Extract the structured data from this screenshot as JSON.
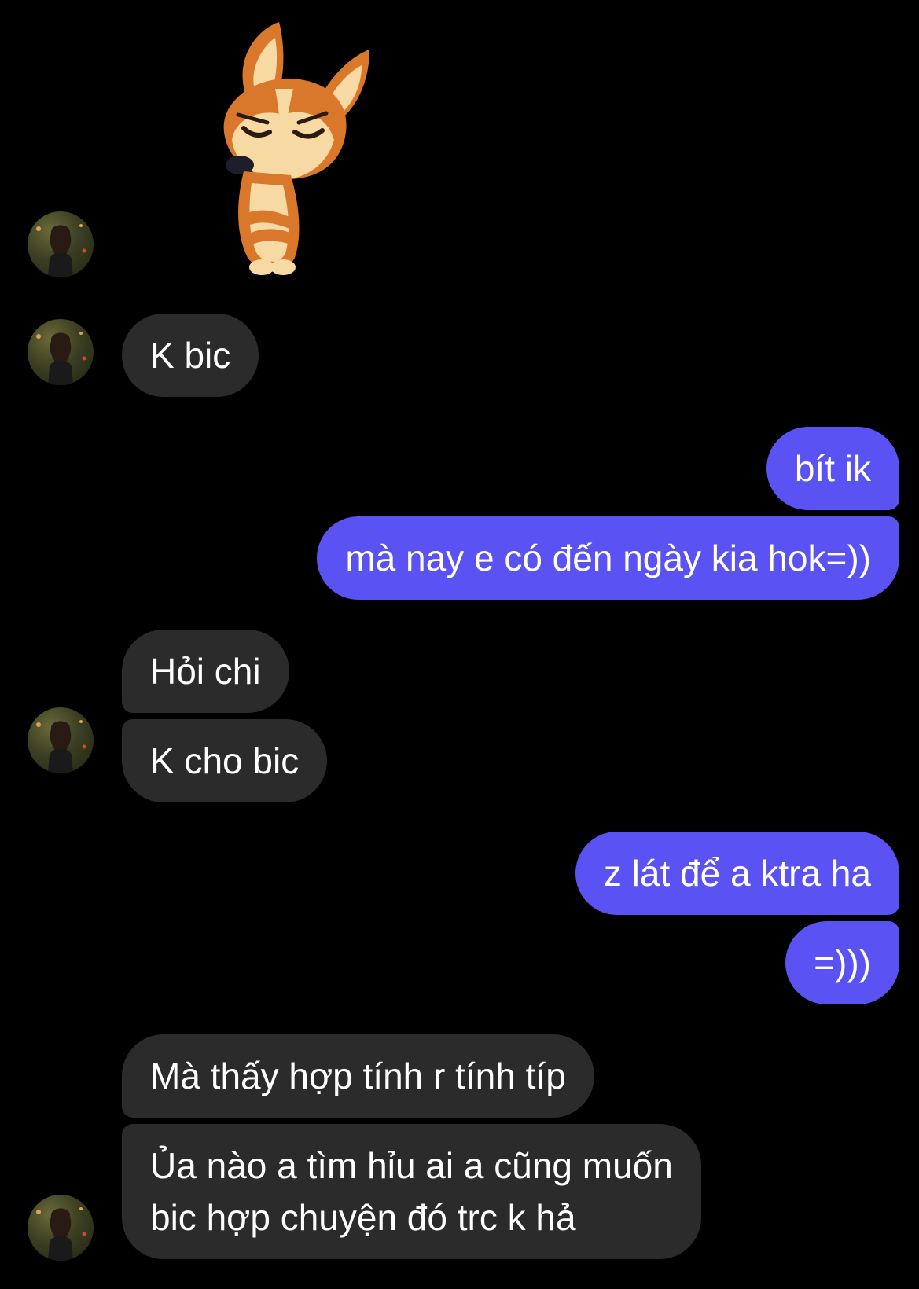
{
  "conversation": {
    "sticker": {
      "icon": "corgi-sticker-icon"
    },
    "messages": [
      {
        "id": "m1",
        "direction": "incoming",
        "text": "K bic"
      },
      {
        "id": "m2",
        "direction": "outgoing",
        "text": "bít ik"
      },
      {
        "id": "m3",
        "direction": "outgoing",
        "text": "mà nay e có đến ngày kia hok=))"
      },
      {
        "id": "m4",
        "direction": "incoming",
        "text": "Hỏi chi"
      },
      {
        "id": "m5",
        "direction": "incoming",
        "text": "K cho bic"
      },
      {
        "id": "m6",
        "direction": "outgoing",
        "text": "z lát để a ktra ha"
      },
      {
        "id": "m7",
        "direction": "outgoing",
        "text": "=)))"
      },
      {
        "id": "m8",
        "direction": "incoming",
        "text": "Mà thấy hợp tính r tính típ"
      },
      {
        "id": "m9",
        "direction": "incoming",
        "lines": [
          "Ủa nào a tìm hỉu ai a cũng muốn",
          "bic hợp chuyện đó trc k hả"
        ]
      }
    ]
  },
  "colors": {
    "background": "#000000",
    "incoming_bubble": "#2b2b2b",
    "outgoing_bubble": "#5a52f2",
    "text": "#ffffff"
  }
}
